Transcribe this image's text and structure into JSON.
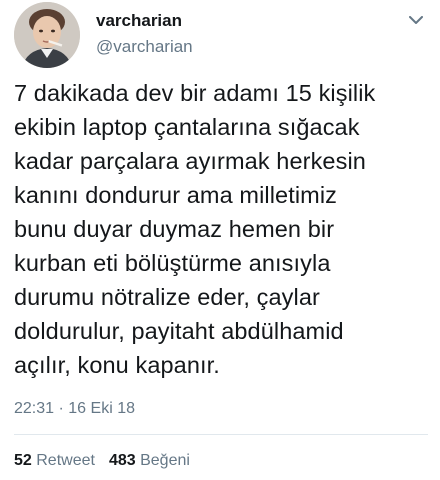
{
  "tweet": {
    "display_name": "varcharian",
    "handle": "@varcharian",
    "text": "7 dakikada dev bir adamı 15 kişilik\nekibin laptop çantalarına sığacak\nkadar parçalara ayırmak herkesin\nkanını dondurur ama milletimiz\nbunu duyar duymaz hemen bir\nkurban eti bölüştürme anısıyla\ndurumu nötralize eder, çaylar\ndoldurulur, payitaht abdülhamid\naçılır, konu kapanır.",
    "time": "22:31",
    "separator": "·",
    "date": "16 Eki 18",
    "retweets": {
      "count": "52",
      "label": "Retweet"
    },
    "likes": {
      "count": "483",
      "label": "Beğeni"
    }
  },
  "icons": {
    "more": "chevron-down-icon",
    "avatar": "avatar-photo"
  },
  "colors": {
    "text": "#14171a",
    "secondary": "#657786",
    "divider": "#e1e8ed"
  }
}
